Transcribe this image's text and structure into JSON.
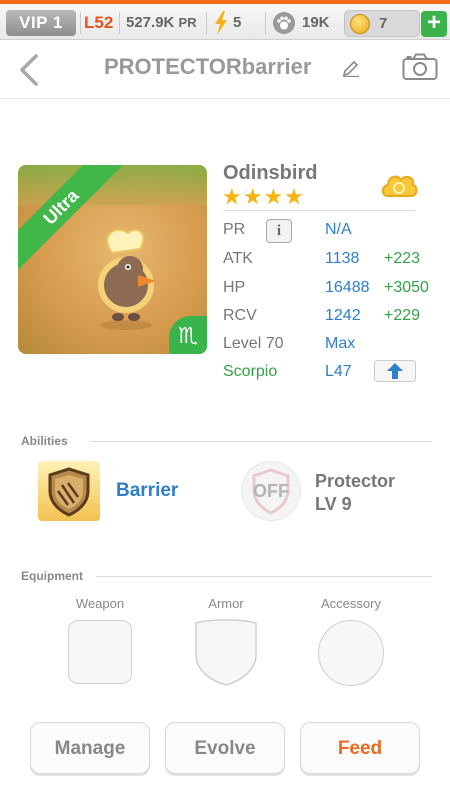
{
  "status_bar": {
    "vip": "VIP 1",
    "level": "L52",
    "pr": "527.9K",
    "pr_suffix": "PR",
    "energy": "5",
    "paws": "19K",
    "coins": "7",
    "plus_label": "+",
    "accent_color": "#f06a1a"
  },
  "header": {
    "title": "PROTECTORbarrier",
    "back_icon": "chevron-left-icon",
    "edit_icon": "pencil-icon",
    "camera_icon": "camera-icon"
  },
  "pet": {
    "rarity": "Ultra",
    "name": "Odinsbird",
    "stars": "★★★★",
    "star_count": 4,
    "sign_glyph": "♏",
    "stats": [
      {
        "label": "PR",
        "value": "N/A",
        "bonus": ""
      },
      {
        "label": "ATK",
        "value": "1138",
        "bonus": "+223"
      },
      {
        "label": "HP",
        "value": "16488",
        "bonus": "+3050"
      },
      {
        "label": "RCV",
        "value": "1242",
        "bonus": "+229"
      },
      {
        "label": "Level 70",
        "value": "Max",
        "bonus": ""
      },
      {
        "label": "Scorpio",
        "value": "L47",
        "bonus": ""
      }
    ],
    "info_label": "i"
  },
  "abilities": {
    "title": "Abilities",
    "ability1": "Barrier",
    "ability2_state": "OFF",
    "ability2_name": "Protector",
    "ability2_level": "LV 9"
  },
  "equipment": {
    "title": "Equipment",
    "slots": [
      "Weapon",
      "Armor",
      "Accessory"
    ]
  },
  "actions": {
    "manage": "Manage",
    "evolve": "Evolve",
    "feed": "Feed",
    "feed_color": "#ee6a22"
  },
  "colors": {
    "blue": "#2f7ec9",
    "green": "#34a147",
    "star": "#f6b40e"
  }
}
